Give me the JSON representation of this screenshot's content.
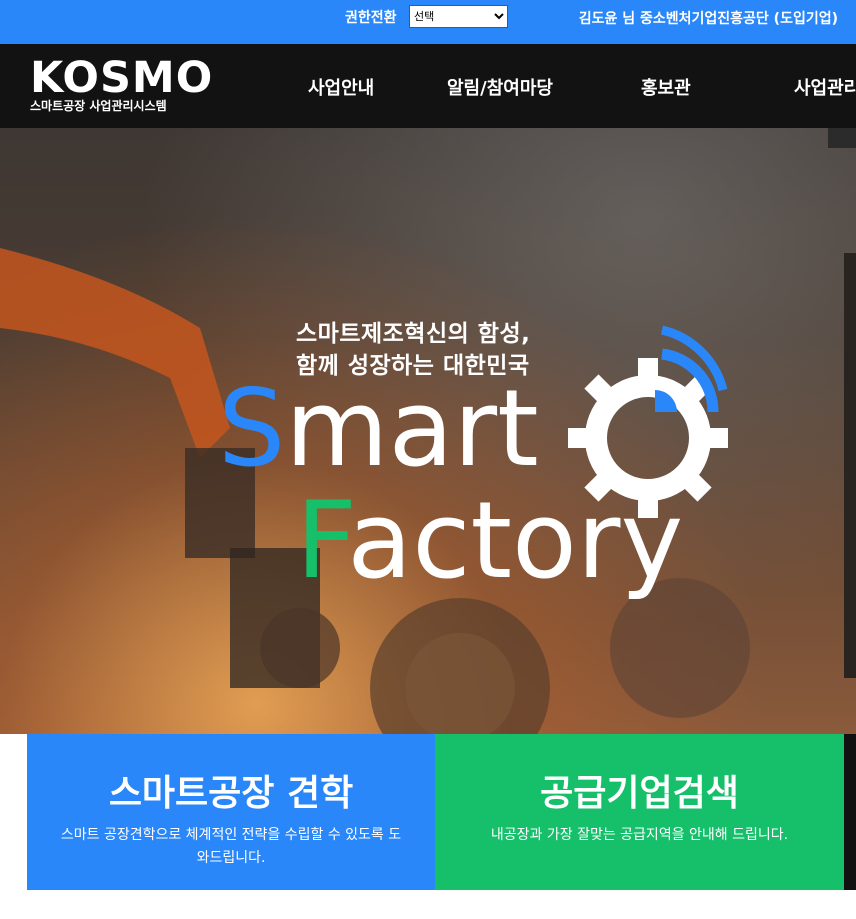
{
  "topbar": {
    "permission_label": "권한전환",
    "permission_select_value": "선택",
    "user_info": "김도윤 님 중소벤처기업진흥공단 (도입기업)"
  },
  "logo": {
    "wordmark": "KOSMO",
    "subtitle": "스마트공장 사업관리시스템"
  },
  "nav": {
    "items": [
      "사업안내",
      "알림/참여마당",
      "홍보관",
      "사업관리"
    ]
  },
  "hero": {
    "slogan_line1": "스마트제조혁신의 함성,",
    "slogan_line2": "함께 성장하는 대한민국",
    "word1_first": "S",
    "word1_rest": "mart",
    "word2_first": "F",
    "word2_rest": "actory"
  },
  "cards": [
    {
      "title": "스마트공장 견학",
      "desc": "스마트 공장견학으로 체계적인 전략을 수립할 수 있도록 도와드립니다."
    },
    {
      "title": "공급기업검색",
      "desc": "내공장과 가장 잘맞는 공급지역을 안내해 드립니다."
    }
  ],
  "colors": {
    "brand_blue": "#2a87fa",
    "brand_green": "#16c06a",
    "nav_bg": "#121212"
  }
}
